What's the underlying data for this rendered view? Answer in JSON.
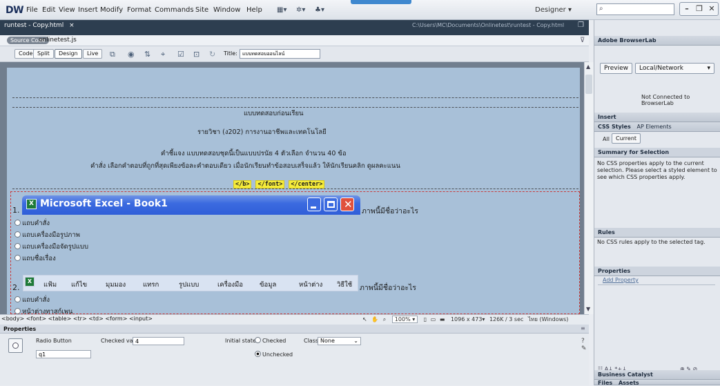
{
  "app": {
    "logo": "DW",
    "menu": [
      "File",
      "Edit",
      "View",
      "Insert",
      "Modify",
      "Format",
      "Commands",
      "Site",
      "Window",
      "Help"
    ],
    "workspace": "Designer",
    "search_placeholder": ""
  },
  "document": {
    "tab": "runtest - Copy.html",
    "tab_close": "×",
    "path": "C:\\Users\\MC\\Documents\\Onlinetest\\runtest - Copy.html",
    "source_code_label": "Source Code",
    "related_file": "onlinetest.js"
  },
  "toolbar": {
    "views": [
      "Code",
      "Split",
      "Design",
      "Live"
    ],
    "active_view": "Design",
    "title_label": "Title:",
    "title_value": "แบบทดสอบออนไลน์"
  },
  "content": {
    "heading1": "แบบทดสอบก่อนเรียน",
    "heading2": "รายวิชา (ง202) การงานอาชีพและเทคโนโลยี",
    "instruction1": "คำชี้แจง แบบทดสอบชุดนี้เป็นแบบปรนัย 4 ตัวเลือก จำนวน 40 ข้อ",
    "instruction2": "คำสั่ง เลือกคำตอบที่ถูกที่สุดเพียงข้อละคำตอบเดียว เมื่อนักเรียนทำข้อสอบเสร็จแล้ว ให้นักเรียนคลิก ดูผลคะแนน",
    "tags": [
      "</b>",
      "</font>",
      "</center>"
    ],
    "q1": {
      "number": "1.",
      "image_title": "Microsoft Excel - Book1",
      "question": "ภาพนี้มีชื่อว่าอะไร",
      "options": [
        "แถบคำสั่ง",
        "แถบเครื่องมือรูปภาพ",
        "แถบเครื่องมือจัดรูปแบบ",
        "แถบชื่อเรื่อง"
      ]
    },
    "q2": {
      "number": "2.",
      "image_menu": [
        "แฟ้ม",
        "แก้ไข",
        "มุมมอง",
        "แทรก",
        "รูปแบบ",
        "เครื่องมือ",
        "ข้อมูล",
        "หน้าต่าง",
        "วิธีใช้"
      ],
      "question": "ภาพนี้มีชื่อว่าอะไร",
      "options": [
        "แถบคำสั่ง",
        "หน้าต่างทาสก์เพน"
      ]
    }
  },
  "status": {
    "tagpath": "<body> <font> <table> <tr> <td> <form> <input>",
    "zoom": "100%",
    "size": "1096 x 473",
    "download": "126K / 3 sec",
    "encoding": "ไทย (Windows)"
  },
  "properties": {
    "title": "Properties",
    "element_type": "Radio Button",
    "name_value": "q1",
    "checked_value_label": "Checked value",
    "checked_value": "4",
    "initial_state_label": "Initial state",
    "state_checked": "Checked",
    "state_unchecked": "Unchecked",
    "class_label": "Class",
    "class_value": "None"
  },
  "right_panel": {
    "browserlab_title": "Adobe BrowserLab",
    "preview_btn": "Preview",
    "local_network": "Local/Network",
    "not_connected": "Not Connected to BrowserLab",
    "insert_title": "Insert",
    "css_tabs": [
      "CSS Styles",
      "AP Elements"
    ],
    "mode_all": "All",
    "mode_current": "Current",
    "summary_title": "Summary for Selection",
    "summary_text": "No CSS properties apply to the current selection. Please select a styled element to see which CSS properties apply.",
    "rules_title": "Rules",
    "rules_text": "No CSS rules apply to the selected tag.",
    "properties_title": "Properties",
    "add_property": "Add Property",
    "business_catalyst": "Business Catalyst",
    "files_tabs": [
      "Files",
      "Assets"
    ]
  }
}
